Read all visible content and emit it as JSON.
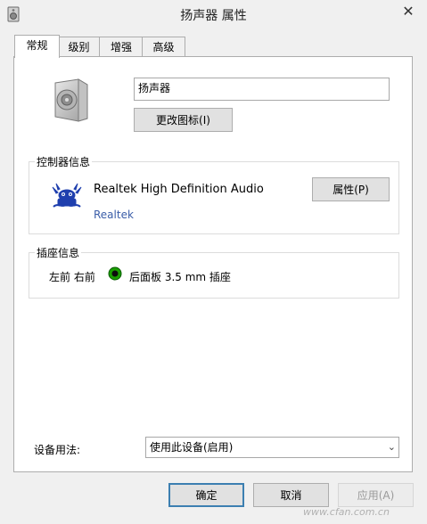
{
  "window": {
    "title": "扬声器 属性",
    "close_glyph": "✕"
  },
  "tabs": [
    {
      "label": "常规"
    },
    {
      "label": "级别"
    },
    {
      "label": "增强"
    },
    {
      "label": "高级"
    }
  ],
  "general": {
    "device_name_value": "扬声器",
    "change_icon_label": "更改图标(I)",
    "controller": {
      "title": "控制器信息",
      "name": "Realtek High Definition Audio",
      "vendor": "Realtek",
      "properties_label": "属性(P)"
    },
    "jack": {
      "title": "插座信息",
      "position": "左前 右前",
      "jack_label": "后面板 3.5 mm 插座",
      "jack_color": "#1aa000"
    },
    "usage": {
      "label": "设备用法:",
      "selected": "使用此设备(启用)"
    }
  },
  "footer": {
    "ok_label": "确定",
    "cancel_label": "取消",
    "apply_label": "应用(A)"
  },
  "watermark": "www.cfan.com.cn",
  "colors": {
    "link": "#3a5da8",
    "accent_border": "#3c7fb1"
  }
}
